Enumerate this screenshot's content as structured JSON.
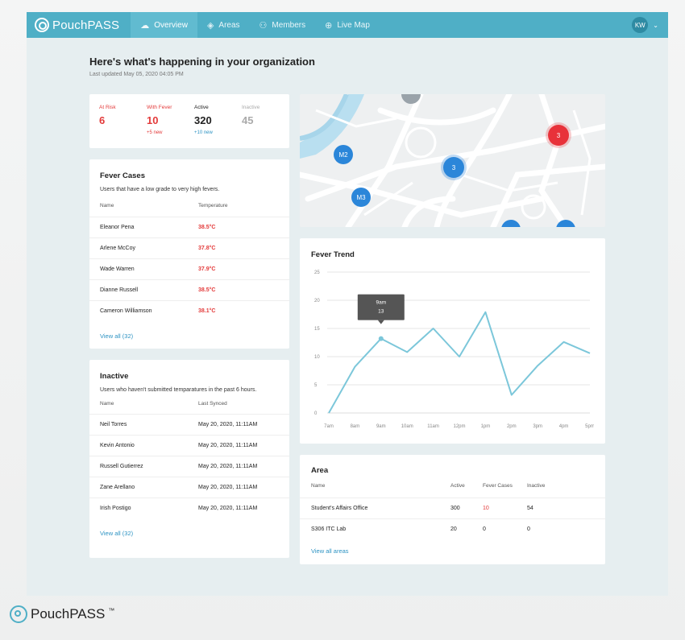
{
  "brand": {
    "name_light": "Pouch",
    "name_bold": "PASS",
    "footer_name": "PouchPASS",
    "tm": "™"
  },
  "nav": {
    "items": [
      {
        "label": "Overview",
        "icon": "cloud-icon",
        "glyph": "☁"
      },
      {
        "label": "Areas",
        "icon": "layers-icon",
        "glyph": "◈"
      },
      {
        "label": "Members",
        "icon": "members-icon",
        "glyph": "⚇"
      },
      {
        "label": "Live Map",
        "icon": "crosshair-icon",
        "glyph": "⊕"
      }
    ],
    "avatar_initials": "KW",
    "chevron": "⌄"
  },
  "header": {
    "title": "Here's what's happening in your organization",
    "updated": "Last updated May 05, 2020 04:05 PM"
  },
  "stats": [
    {
      "label": "At Risk",
      "value": "6",
      "sub": ""
    },
    {
      "label": "With Fever",
      "value": "10",
      "sub": "+5 new"
    },
    {
      "label": "Active",
      "value": "320",
      "sub": "+10 new"
    },
    {
      "label": "Inactive",
      "value": "45",
      "sub": ""
    }
  ],
  "map": {
    "pins": [
      {
        "label": "M2"
      },
      {
        "label": "3"
      },
      {
        "label": "M3"
      },
      {
        "label": "3"
      },
      {
        "label": ""
      },
      {
        "label": ""
      },
      {
        "label": ""
      }
    ]
  },
  "fever_cases": {
    "title": "Fever Cases",
    "subtitle": "Users that have a low grade to very high fevers.",
    "col_name": "Name",
    "col_temp": "Temperature",
    "rows": [
      {
        "name": "Eleanor Pena",
        "temp": "38.5°C"
      },
      {
        "name": "Arlene McCoy",
        "temp": "37.8°C"
      },
      {
        "name": "Wade Warren",
        "temp": "37.9°C"
      },
      {
        "name": "Dianne Russell",
        "temp": "38.5°C"
      },
      {
        "name": "Cameron Williamson",
        "temp": "38.1°C"
      }
    ],
    "view_all": "View all (32)"
  },
  "inactive": {
    "title": "Inactive",
    "subtitle": "Users who haven't submitted temparatures in the past 6 hours.",
    "col_name": "Name",
    "col_synced": "Last Synced",
    "rows": [
      {
        "name": "Neil Torres",
        "synced": "May 20, 2020, 11:11AM"
      },
      {
        "name": "Kevin Antonio",
        "synced": "May 20, 2020, 11:11AM"
      },
      {
        "name": "Russell Gutierrez",
        "synced": "May 20, 2020, 11:11AM"
      },
      {
        "name": "Zane Arellano",
        "synced": "May 20, 2020, 11:11AM"
      },
      {
        "name": "Irish Postigo",
        "synced": "May 20, 2020, 11:11AM"
      }
    ],
    "view_all": "View all (32)"
  },
  "fever_trend": {
    "title": "Fever Trend",
    "tooltip": {
      "label": "9am",
      "value": "13"
    }
  },
  "chart_data": {
    "type": "line",
    "title": "Fever Trend",
    "categories": [
      "7am",
      "8am",
      "9am",
      "10am",
      "11am",
      "12pm",
      "1pm",
      "2pm",
      "3pm",
      "4pm",
      "5pm"
    ],
    "series": [
      {
        "values": [
          0,
          8.2,
          13.2,
          10.8,
          15,
          10,
          17.9,
          3.2,
          8.4,
          12.6,
          10.6
        ]
      }
    ],
    "ylim": [
      0,
      25
    ],
    "yticks": [
      0,
      5,
      10,
      15,
      20,
      25
    ],
    "grid": true,
    "color": "#7cc7da"
  },
  "area_table": {
    "title": "Area",
    "cols": [
      "Name",
      "Active",
      "Fever Cases",
      "Inactive"
    ],
    "rows": [
      {
        "name": "Student's Affairs Office",
        "active": "300",
        "fever": "10",
        "inactive": "54"
      },
      {
        "name": "S306 ITC Lab",
        "active": "20",
        "fever": "0",
        "inactive": "0"
      }
    ],
    "view_all": "View all areas"
  },
  "colors": {
    "nav": "#4fafc6",
    "accent_blue": "#2d93c3",
    "red": "#e33a3a",
    "pin_blue": "#2b86d9",
    "pin_red": "#e8323a"
  }
}
